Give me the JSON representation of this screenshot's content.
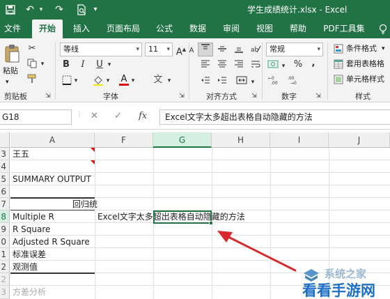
{
  "titlebar": {
    "save_icon": "save-icon",
    "undo_icon": "undo-icon",
    "redo_icon": "redo-icon",
    "preview_icon": "print-preview-icon",
    "more_icon": "quick-access-more-icon",
    "title": "学生成绩统计.xlsx  -  Excel"
  },
  "tabs": [
    "文件",
    "开始",
    "插入",
    "页面布局",
    "公式",
    "数据",
    "审阅",
    "视图",
    "帮助",
    "PDF工具集"
  ],
  "active_tab": "开始",
  "ribbon": {
    "clipboard": {
      "paste": "粘贴",
      "label": "剪贴板"
    },
    "font": {
      "name": "等线",
      "size": "11",
      "bold": "B",
      "italic": "I",
      "underline": "U",
      "font_color_letter": "A",
      "grow": "A",
      "shrink": "A",
      "label": "字体"
    },
    "alignment": {
      "label": "对齐方式"
    },
    "number": {
      "format": "常规",
      "percent": "%",
      "comma": ",",
      "label": "数字"
    },
    "styles": {
      "conditional": "条件格式",
      "table": "套用表格格",
      "cell": "单元格样式",
      "label": "样式"
    }
  },
  "formula_bar": {
    "name_box": "G18",
    "cancel": "✕",
    "enter": "✓",
    "fx": "fx",
    "content": "Excel文字太多超出表格自动隐藏的方法"
  },
  "columns": [
    "A",
    "F",
    "G",
    "H",
    "I",
    "J"
  ],
  "selected_column": "G",
  "rows": [
    "3",
    "4",
    "5",
    "6",
    "7",
    "8",
    "9",
    "0",
    "1",
    "2",
    "2",
    "3"
  ],
  "selected_row": "8",
  "cells": {
    "a3": "王五",
    "a5": "SUMMARY OUTPUT",
    "a7": "回归统",
    "a8": "Multiple R",
    "a9": "R Square",
    "a10": "Adjusted R Square",
    "a11": "标准误差",
    "a12": "观测值",
    "a14": "方差分析",
    "f8": "Excel文字太多超出表格自动隐藏的方法"
  },
  "watermark": {
    "top": "系统之家",
    "bottom": "看看手游网"
  },
  "colors": {
    "accent": "#217346",
    "arrow": "#d9292d"
  }
}
